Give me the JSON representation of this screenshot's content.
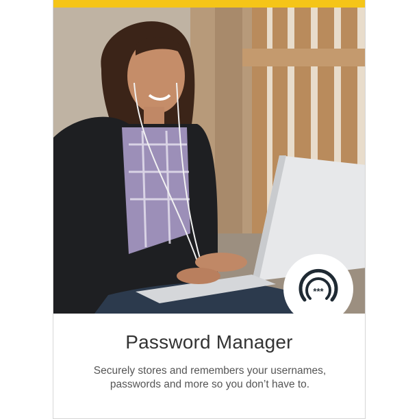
{
  "product": {
    "title": "Password Manager",
    "description": "Securely stores and remembers your usernames, passwords and more so you don’t have to.",
    "badge_icon": "password-masked-icon",
    "badge_icon_text": "***"
  },
  "colors": {
    "accent": "#f5c518",
    "title_text": "#333333",
    "body_text": "#555555"
  }
}
